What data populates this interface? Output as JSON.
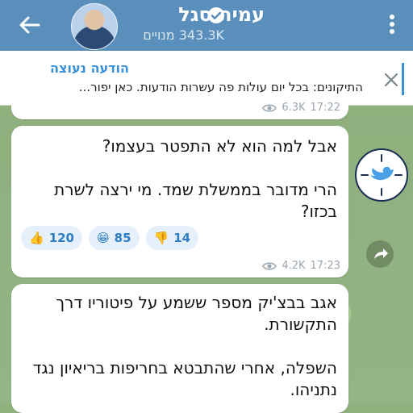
{
  "header": {
    "channel_name": "עמית סגל",
    "subscribers": "343.3K מנויים",
    "icons": [
      "back-arrow-icon",
      "verified-icon",
      "more-vertical-icon"
    ]
  },
  "pinned": {
    "title": "הודעה נעוצה",
    "text": "התיקונים: בכל יום עולות פה עשרות הודעות. כאן יפור..."
  },
  "messages": [
    {
      "views": "6.3K",
      "time": "17:22"
    },
    {
      "text": "אבל למה הוא לא התפטר בעצמו?\n\nהרי מדובר בממשלת שמד. מי ירצה לשרת בכזו?",
      "reactions": [
        {
          "emoji": "👍",
          "count": "120"
        },
        {
          "emoji": "😁",
          "count": "85"
        },
        {
          "emoji": "👎",
          "count": "14"
        }
      ],
      "views": "4.2K",
      "time": "17:23"
    },
    {
      "text": "אגב בבצ'יק מספר ששמע על פיטוריו דרך התקשורת.\n\nהשפלה, אחרי שהתבטא בחריפות בריאיון נגד נתניהו."
    }
  ],
  "colors": {
    "header": "#5a8fbb",
    "accent": "#3a90d6"
  }
}
